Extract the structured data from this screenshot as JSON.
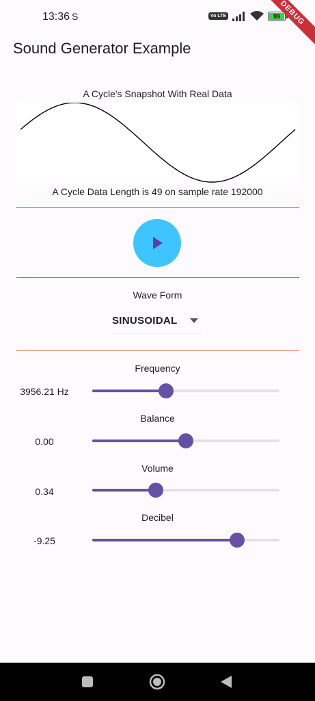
{
  "status_bar": {
    "time": "13:36",
    "notification_icon": "S",
    "volte": "Vo LTE",
    "battery": "99",
    "debug_banner": "DEBUG"
  },
  "app": {
    "title": "Sound Generator Example"
  },
  "waveform_preview": {
    "title": "A Cycle's Snapshot With Real Data",
    "caption": "A Cycle Data Length is 49 on sample rate 192000"
  },
  "play": {
    "icon": "play-icon"
  },
  "wave_form": {
    "label": "Wave Form",
    "selected": "SINUSOIDAL"
  },
  "sliders": [
    {
      "title": "Frequency",
      "value": "3956.21 Hz",
      "fraction": 0.394
    },
    {
      "title": "Balance",
      "value": "0.00",
      "fraction": 0.5
    },
    {
      "title": "Volume",
      "value": "0.34",
      "fraction": 0.34
    },
    {
      "title": "Decibel",
      "value": "-9.25",
      "fraction": 0.773
    }
  ],
  "nav": {
    "icons": [
      "recents-icon",
      "home-icon",
      "back-icon"
    ]
  },
  "colors": {
    "accent": "#6750A4",
    "play": "#40C4FF",
    "divider": "#E0594B"
  }
}
